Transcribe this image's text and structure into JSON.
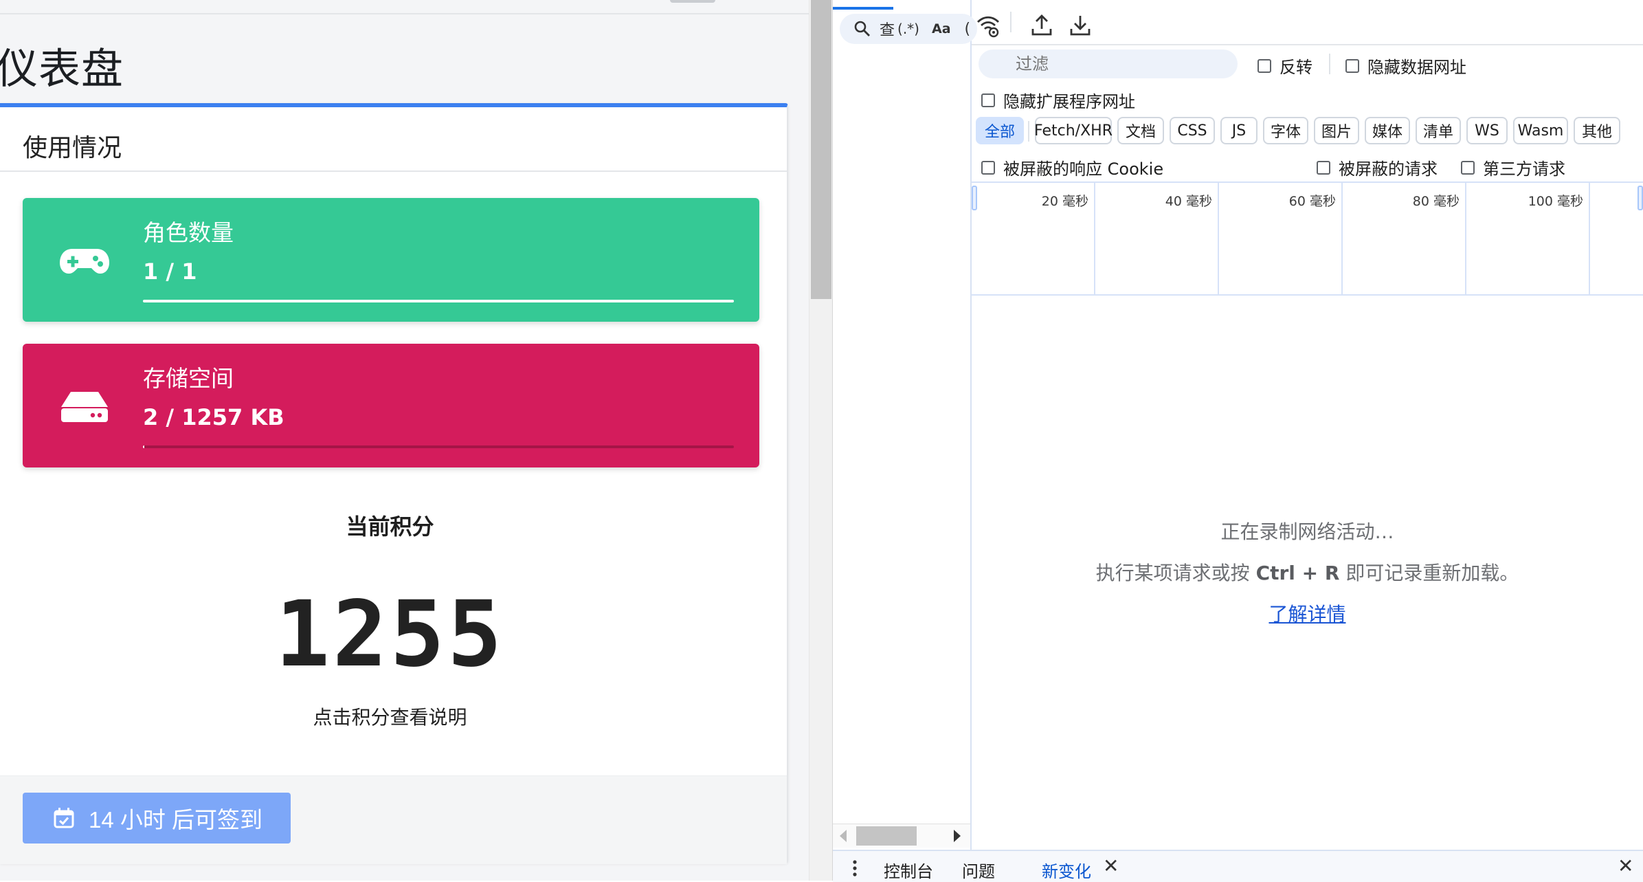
{
  "page": {
    "title": "仪表盘",
    "usage_card": {
      "title": "使用情况",
      "roles": {
        "label": "角色数量",
        "value": "1 / 1",
        "progress": 1.0,
        "color": "#35c995",
        "icon": "gamepad-icon"
      },
      "storage": {
        "label": "存储空间",
        "value": "2 / 1257 KB",
        "progress": 0.0016,
        "color": "#d41c5c",
        "icon": "hard-drive-icon"
      },
      "score": {
        "title": "当前积分",
        "value": "1255",
        "hint": "点击积分查看说明"
      },
      "checkin_button": {
        "label": "14 小时 后可签到",
        "icon": "calendar-check-icon",
        "color": "#7da7f8"
      }
    }
  },
  "devtools": {
    "search": {
      "label": "查",
      "regex_label": "(.*)",
      "case_label": "Aa",
      "extra": "("
    },
    "network": {
      "filter": {
        "placeholder": "过滤",
        "invert_label": "反转",
        "hide_data_urls_label": "隐藏数据网址",
        "hide_ext_urls_label": "隐藏扩展程序网址"
      },
      "types": [
        "全部",
        "Fetch/XHR",
        "文档",
        "CSS",
        "JS",
        "字体",
        "图片",
        "媒体",
        "清单",
        "WS",
        "Wasm",
        "其他"
      ],
      "active_type": "全部",
      "blocked": {
        "cookies_label": "被屏蔽的响应 Cookie",
        "requests_label": "被屏蔽的请求",
        "third_party_label": "第三方请求"
      },
      "timeline_ticks": [
        "20 毫秒",
        "40 毫秒",
        "60 毫秒",
        "80 毫秒",
        "100 毫秒"
      ],
      "empty": {
        "recording": "正在录制网络活动…",
        "hint_prefix": "执行某项请求或按",
        "hint_key": "Ctrl + R",
        "hint_suffix": "即可记录重新加载。",
        "learn_more": "了解详情"
      }
    },
    "drawer": {
      "tabs": [
        "控制台",
        "问题",
        "新变化"
      ],
      "active_tab": "新变化"
    }
  }
}
